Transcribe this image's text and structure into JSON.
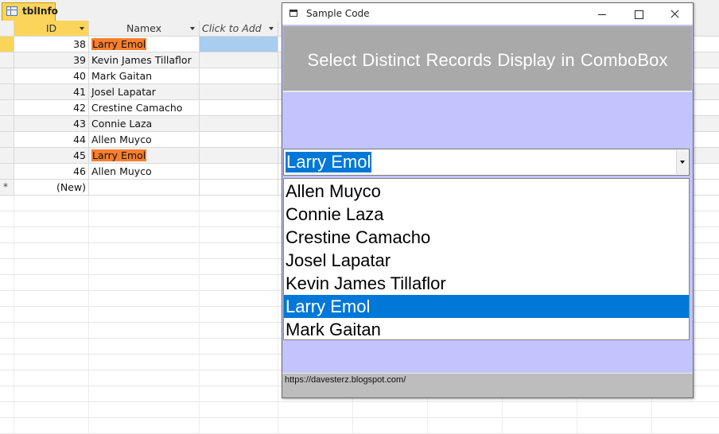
{
  "datasheet": {
    "tab_label": "tblInfo",
    "columns": [
      "ID",
      "Namex",
      "Click to Add"
    ],
    "rows": [
      {
        "id": "38",
        "name": "Larry Emol",
        "highlight": true,
        "current": true
      },
      {
        "id": "39",
        "name": "Kevin James Tillaflor",
        "highlight": false,
        "current": false
      },
      {
        "id": "40",
        "name": "Mark Gaitan",
        "highlight": false,
        "current": false
      },
      {
        "id": "41",
        "name": "Josel Lapatar",
        "highlight": false,
        "current": false
      },
      {
        "id": "42",
        "name": "Crestine Camacho",
        "highlight": false,
        "current": false
      },
      {
        "id": "43",
        "name": "Connie Laza",
        "highlight": false,
        "current": false
      },
      {
        "id": "44",
        "name": "Allen Muyco",
        "highlight": false,
        "current": false
      },
      {
        "id": "45",
        "name": "Larry Emol",
        "highlight": true,
        "current": false
      },
      {
        "id": "46",
        "name": "Allen Muyco",
        "highlight": false,
        "current": false
      }
    ],
    "new_row_marker": "*",
    "new_row_label": "(New)"
  },
  "window": {
    "title": "Sample Code",
    "banner": "Select Distinct  Records Display in ComboBox",
    "combo_value": "Larry Emol",
    "list_items": [
      "Allen Muyco",
      "Connie Laza",
      "Crestine Camacho",
      "Josel Lapatar",
      "Kevin James Tillaflor",
      "Larry Emol",
      "Mark Gaitan"
    ],
    "selected_item": "Larry Emol",
    "status_text": "https://davesterz.blogspot.com/"
  },
  "colors": {
    "highlight": "#f77f2e",
    "form_background": "#c3c3fe",
    "selection": "#0078d7",
    "active_tab": "#fbd45a"
  }
}
